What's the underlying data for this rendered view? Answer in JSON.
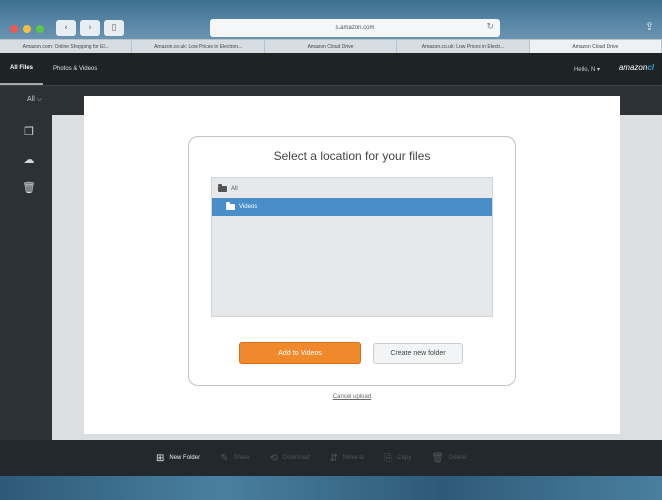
{
  "browser": {
    "url": "s.amazon.com",
    "reload_icon": "reload-icon",
    "share_icon": "share-icon",
    "nav": {
      "back": "‹",
      "forward": "›",
      "sidebar": "▯"
    },
    "tabs": [
      "Amazon.com: Online Shopping for El...",
      "Amazon.co.uk: Low Prices in Electron...",
      "Amazon Cloud Drive",
      "Amazon.co.uk: Low Prices in Electr...",
      "Amazon Cloud Drive"
    ],
    "traffic_colors": [
      "#ee5a52",
      "#f5be3f",
      "#5cc447"
    ]
  },
  "app": {
    "tabs": [
      "All Files",
      "Photos & Videos"
    ],
    "hello": "Hello, N ▾",
    "logo_text": "amazon",
    "logo_suffix": "cl"
  },
  "subbar": {
    "crumb": "All ⌵"
  },
  "modal": {
    "title": "Select a location for your files",
    "tree": {
      "root": "All",
      "selected": "Videos"
    },
    "primary_button": "Add to Videos",
    "secondary_button": "Create new folder",
    "cancel": "Cancel upload"
  },
  "toolbar": {
    "new_folder": "New Folder",
    "disabled": [
      "Share",
      "Download",
      "Move to",
      "Copy",
      "Delete"
    ]
  },
  "colors": {
    "accent_orange": "#f0892c",
    "selection_blue": "#4a8ec9",
    "header_dark": "#1e2326"
  }
}
